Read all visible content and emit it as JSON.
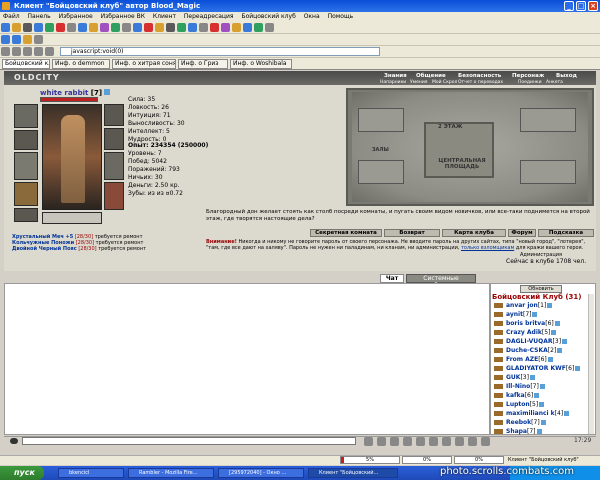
{
  "window": {
    "title": "Клиент \"Бойцовский клуб\" автор Blood_Magic"
  },
  "menu": [
    "Файл",
    "Панель",
    "Избранное",
    "Избранное ВК",
    "Клиент",
    "Переадресация",
    "Бойцовский клуб",
    "Окна",
    "Помощь"
  ],
  "address": "javascript:void(0)",
  "tabs": [
    "Бойцовский клуб",
    "Инф. о demmon",
    "Инф. о хитрая соня",
    "Инф. о Гриз",
    "Инф. о Woshibala"
  ],
  "game": {
    "logo": "OLDCITY",
    "topnav": [
      "Знания",
      "Общение",
      "Безопасность",
      "Персонаж",
      "Выход"
    ],
    "subnav": [
      "Напарники",
      "Умения",
      "Мой Скрол",
      "Отчет о переводах",
      "Поединки",
      "Анкета"
    ],
    "character": {
      "name": "white rabbit",
      "level": "[7]"
    },
    "stats": [
      "Сила: 35",
      "Ловкость: 26",
      "Интуиция: 71",
      "Выносливость: 30",
      "Интеллект: 5",
      "Мудрость: 0"
    ],
    "stats2": {
      "exp": "Опыт: 234354 (250000)",
      "level": "Уровень: 7",
      "wins": "Побед: 5042",
      "losses": "Поражений: 793",
      "draws": "Ничьих: 30",
      "money": "Деньги: 2.50 кр.",
      "teeth": "Зубы: из из ¤0.72"
    },
    "map": {
      "floor": "2 ЭТАЖ",
      "square": "ЦЕНТРАЛЬНАЯ ПЛОЩАДЬ",
      "halls": "ЗАЛЫ"
    },
    "welcome": "Благородный дон желает стоять как столб посреди комнаты, и пугать своим видом новичков, или все-таки поднимется на второй этаж, где творятся настоящие дела?",
    "buttons": [
      "Секретная комната",
      "Возврат",
      "Карта клуба",
      "Форум",
      "Подсказка"
    ],
    "warning_label": "Внимание!",
    "warning": "Никогда и никому не говорите пароль от своего персонажа. Не вводите пароль на других сайтах, типа \"новый город\", \"лотерея\", \"там, где все дают на халяву\". Пароль не нужен ни паладинам, ни кланам, ни администрации,",
    "warning_link": "только взломщикам",
    "warning_end": "для кражи вашего героя.",
    "admin": "Администрация",
    "online": "Сейчас в клубе 1708 чел.",
    "items": [
      {
        "name": "Хрустальный Меч +5",
        "count": "[28/30]",
        "note": "требуется ремонт"
      },
      {
        "name": "Кольчужные Поножи",
        "count": "[28/30]",
        "note": "требуется ремонт"
      },
      {
        "name": "Двойной Черный Пояс",
        "count": "[28/30]",
        "note": "требуется ремонт"
      }
    ]
  },
  "chat": {
    "tab_chat": "Чат",
    "tab_system": "Системные сообщения",
    "refresh": "Обновить"
  },
  "club": {
    "title": "Бойцовский Клуб (31)",
    "users": [
      {
        "name": "anvar jon",
        "lv": "[1]"
      },
      {
        "name": "aynit",
        "lv": "[7]"
      },
      {
        "name": "boris britva",
        "lv": "[6]"
      },
      {
        "name": "Crazy Adik",
        "lv": "[5]"
      },
      {
        "name": "DAGLI-VUQAR",
        "lv": "[3]"
      },
      {
        "name": "Duche-CSKA",
        "lv": "[2]"
      },
      {
        "name": "From AZE",
        "lv": "[6]"
      },
      {
        "name": "GLADIYATOR KWF",
        "lv": "[6]"
      },
      {
        "name": "GUK",
        "lv": "[3]"
      },
      {
        "name": "Ill-Nino",
        "lv": "[7]"
      },
      {
        "name": "kafka",
        "lv": "[6]"
      },
      {
        "name": "Lupton",
        "lv": "[5]"
      },
      {
        "name": "maximilianci k",
        "lv": "[4]"
      },
      {
        "name": "Reebok",
        "lv": "[7]"
      },
      {
        "name": "Shapa",
        "lv": "[7]"
      }
    ]
  },
  "clock": "17:29",
  "status": {
    "p1": "5%",
    "p2": "0%",
    "p3": "0%",
    "text": "Клиент \"Бойцовский клуб\""
  },
  "taskbar": {
    "start": "пуск",
    "tasks": [
      "bkencicl",
      "Rambler - Mozilla Fire...",
      "[295972040] - Окно ...",
      "Клиент \"Бойцовский..."
    ]
  },
  "watermark": "photo.scrolls.combats.com"
}
